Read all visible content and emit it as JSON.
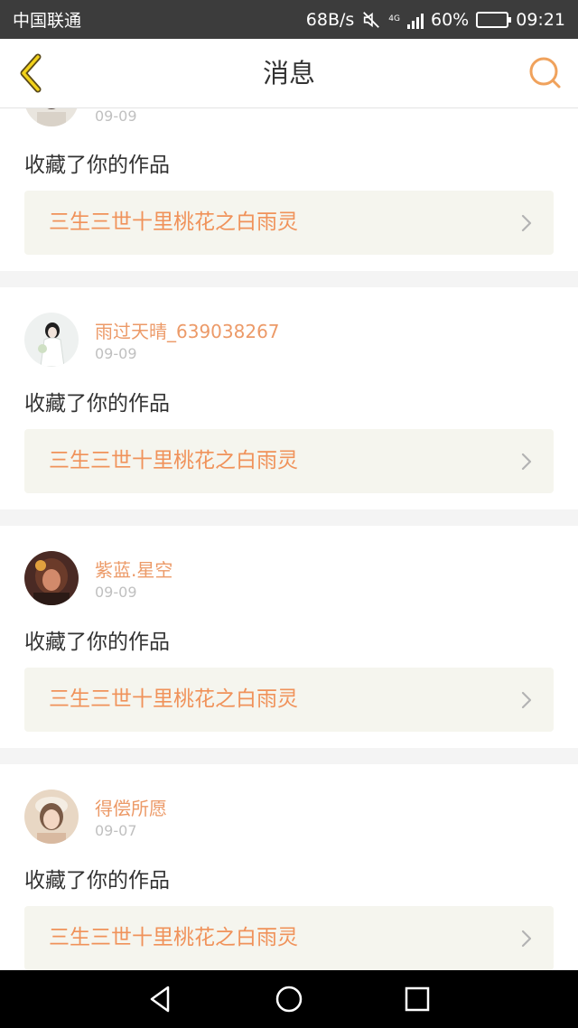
{
  "status_bar": {
    "carrier": "中国联通",
    "speed": "68B/s",
    "network": "4G",
    "battery": "60%",
    "battery_level": 0.6,
    "time": "09:21",
    "icons": [
      "mute-icon",
      "signal-icon",
      "battery-icon"
    ]
  },
  "nav": {
    "title": "消息",
    "back_icon": "chevron-left-icon",
    "search_icon": "search-icon",
    "accent_color": "#f0a25c"
  },
  "messages": [
    {
      "username": "",
      "date": "09-09",
      "action": "收藏了你的作品",
      "work_title": "三生三世十里桃花之白雨灵",
      "avatar_colors": [
        "#e9e5de",
        "#5a4b44"
      ]
    },
    {
      "username": "雨过天晴_639038267",
      "date": "09-09",
      "action": "收藏了你的作品",
      "work_title": "三生三世十里桃花之白雨灵",
      "avatar_colors": [
        "#eef1f0",
        "#1f1f1f"
      ]
    },
    {
      "username": "紫蓝.星空",
      "date": "09-09",
      "action": "收藏了你的作品",
      "work_title": "三生三世十里桃花之白雨灵",
      "avatar_colors": [
        "#4a2a24",
        "#d28a6b"
      ]
    },
    {
      "username": "得偿所愿",
      "date": "09-07",
      "action": "收藏了你的作品",
      "work_title": "三生三世十里桃花之白雨灵",
      "avatar_colors": [
        "#e8d7c4",
        "#7a5a46"
      ]
    }
  ],
  "system_nav": {
    "back_icon": "triangle-back-icon",
    "home_icon": "circle-home-icon",
    "recent_icon": "square-recent-icon"
  }
}
